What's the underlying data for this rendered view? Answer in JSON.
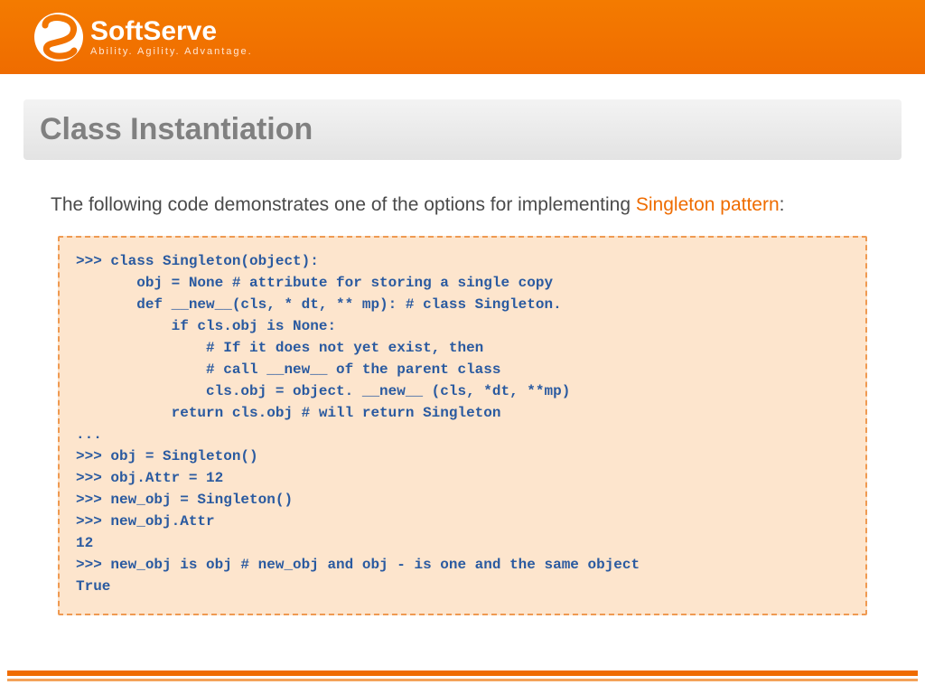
{
  "brand": {
    "name": "SoftServe",
    "tagline": "Ability. Agility. Advantage."
  },
  "title": "Class Instantiation",
  "intro": {
    "pre": "The following code demonstrates one of the options for implementing ",
    "hl": "Singleton pattern",
    "post": ":"
  },
  "code": ">>> class Singleton(object):\n       obj = None # attribute for storing a single copy\n       def __new__(cls, * dt, ** mp): # class Singleton.\n           if cls.obj is None:\n               # If it does not yet exist, then\n               # call __new__ of the parent class\n               cls.obj = object. __new__ (cls, *dt, **mp)\n           return cls.obj # will return Singleton\n...\n>>> obj = Singleton()\n>>> obj.Attr = 12\n>>> new_obj = Singleton()\n>>> new_obj.Attr\n12\n>>> new_obj is obj # new_obj and obj - is one and the same object\nTrue"
}
